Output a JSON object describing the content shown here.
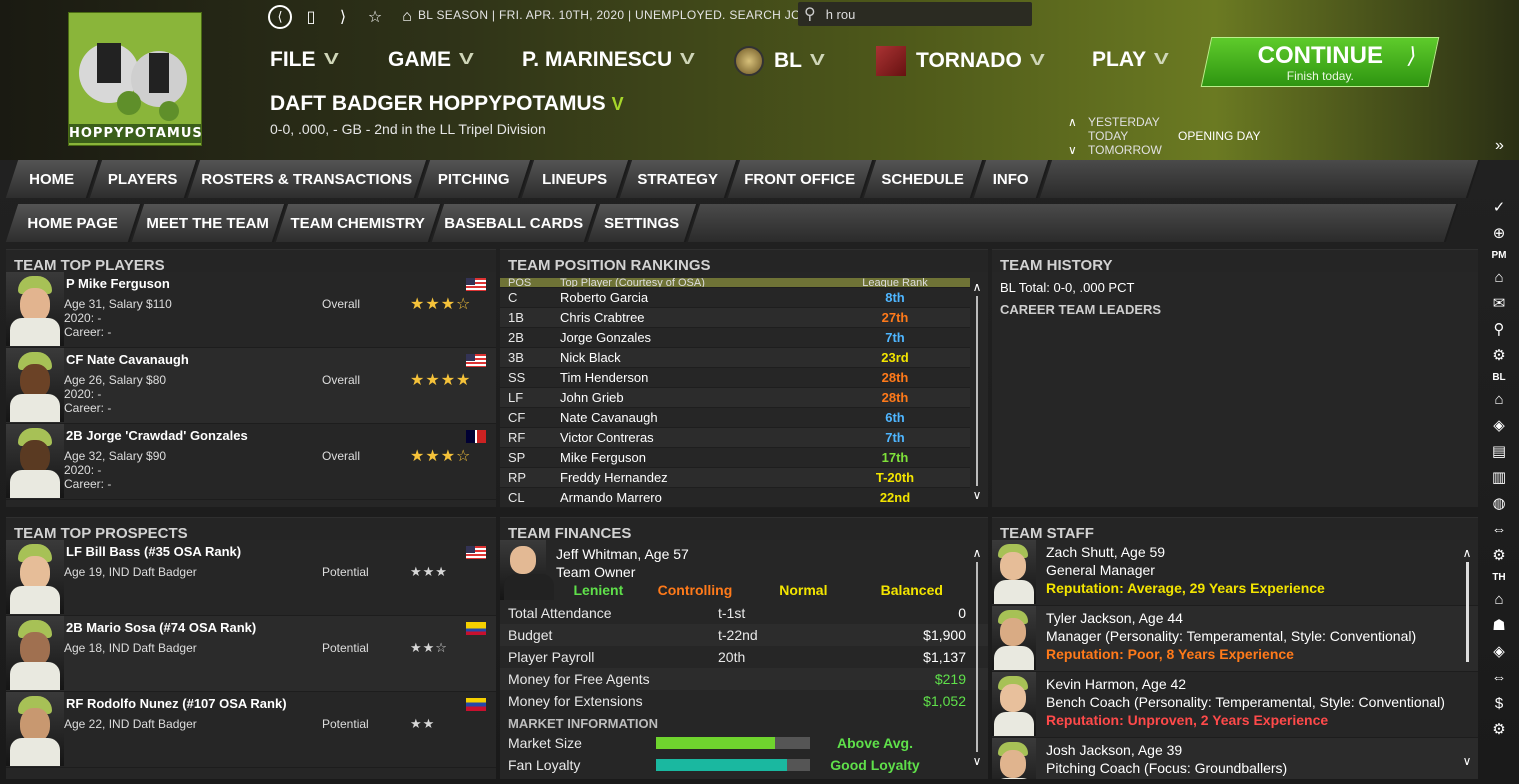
{
  "header": {
    "logo_text": "HOPPYPOTAMUS",
    "season_status": "BL SEASON  |  FRI. APR. 10TH, 2020  |  UNEMPLOYED. SEARCH JOBS...",
    "search_value": "h rou",
    "menu": {
      "file": "FILE",
      "game": "GAME",
      "manager": "P. MARINESCU",
      "league": "BL",
      "team": "TORNADO",
      "play": "PLAY"
    },
    "continue": {
      "title": "CONTINUE",
      "subtitle": "Finish today.",
      "arrow": "⟩"
    },
    "team_name": "DAFT BADGER HOPPYPOTAMUS",
    "team_record": "0-0, .000, - GB - 2nd in the LL Tripel Division",
    "day_nav": {
      "yesterday": "YESTERDAY",
      "today": "TODAY",
      "tomorrow": "TOMORROW",
      "event": "OPENING DAY"
    }
  },
  "tabs": [
    "HOME",
    "PLAYERS",
    "ROSTERS & TRANSACTIONS",
    "PITCHING",
    "LINEUPS",
    "STRATEGY",
    "FRONT OFFICE",
    "SCHEDULE",
    "INFO"
  ],
  "subtabs": [
    "HOME PAGE",
    "MEET THE TEAM",
    "TEAM CHEMISTRY",
    "BASEBALL CARDS",
    "SETTINGS"
  ],
  "top_players": {
    "title": "TEAM TOP PLAYERS",
    "rows": [
      {
        "name": "P Mike Ferguson",
        "line1": "Age 31, Salary $110",
        "line2": "2020: -",
        "line3": "Career: -",
        "label": "Overall",
        "stars": "★★★☆",
        "flag": "us"
      },
      {
        "name": "CF Nate Cavanaugh",
        "line1": "Age 26, Salary $80",
        "line2": "2020: -",
        "line3": "Career: -",
        "label": "Overall",
        "stars": "★★★★",
        "flag": "us"
      },
      {
        "name": "2B Jorge 'Crawdad' Gonzales",
        "line1": "Age 32, Salary $90",
        "line2": "2020: -",
        "line3": "Career: -",
        "label": "Overall",
        "stars": "★★★☆",
        "flag": "dr"
      }
    ]
  },
  "top_prospects": {
    "title": "TEAM TOP PROSPECTS",
    "rows": [
      {
        "name": "LF Bill Bass (#35 OSA Rank)",
        "line1": "Age 19, IND Daft Badger",
        "label": "Potential",
        "stars": "★★★",
        "flag": "us"
      },
      {
        "name": "2B Mario Sosa (#74 OSA Rank)",
        "line1": "Age 18, IND Daft Badger",
        "label": "Potential",
        "stars": "★★☆",
        "flag": "co"
      },
      {
        "name": "RF Rodolfo Nunez (#107 OSA Rank)",
        "line1": "Age 22, IND Daft Badger",
        "label": "Potential",
        "stars": "★★",
        "flag": "ve"
      }
    ]
  },
  "position_rankings": {
    "title": "TEAM POSITION RANKINGS",
    "headers": [
      "POS",
      "Top Player (Courtesy of OSA)",
      "League Rank"
    ],
    "rows": [
      {
        "pos": "C",
        "player": "Roberto Garcia",
        "rank": "8th",
        "color": "#4fb6ff"
      },
      {
        "pos": "1B",
        "player": "Chris Crabtree",
        "rank": "27th",
        "color": "#ff7a1a"
      },
      {
        "pos": "2B",
        "player": "Jorge Gonzales",
        "rank": "7th",
        "color": "#4fb6ff"
      },
      {
        "pos": "3B",
        "player": "Nick Black",
        "rank": "23rd",
        "color": "#f3e500"
      },
      {
        "pos": "SS",
        "player": "Tim Henderson",
        "rank": "28th",
        "color": "#ff7a1a"
      },
      {
        "pos": "LF",
        "player": "John Grieb",
        "rank": "28th",
        "color": "#ff7a1a"
      },
      {
        "pos": "CF",
        "player": "Nate Cavanaugh",
        "rank": "6th",
        "color": "#4fb6ff"
      },
      {
        "pos": "RF",
        "player": "Victor Contreras",
        "rank": "7th",
        "color": "#4fb6ff"
      },
      {
        "pos": "SP",
        "player": "Mike Ferguson",
        "rank": "17th",
        "color": "#7fe23a"
      },
      {
        "pos": "RP",
        "player": "Freddy Hernandez",
        "rank": "T-20th",
        "color": "#f3e500"
      },
      {
        "pos": "CL",
        "player": "Armando Marrero",
        "rank": "22nd",
        "color": "#f3e500"
      }
    ]
  },
  "history": {
    "title": "TEAM HISTORY",
    "bl_total": "BL Total: 0-0, .000 PCT",
    "career_leaders": "CAREER TEAM LEADERS"
  },
  "finances": {
    "title": "TEAM FINANCES",
    "owner": {
      "name": "Jeff Whitman, Age 57",
      "role": "Team Owner",
      "traits": [
        "Lenient",
        "Controlling",
        "Normal",
        "Balanced"
      ],
      "trait_colors": [
        "#5fe04a",
        "#ff7a1a",
        "#f3e500",
        "#f3e500"
      ]
    },
    "rows": [
      {
        "label": "Total Attendance",
        "rank": "t-1st",
        "value": "0",
        "color": "#ffffff"
      },
      {
        "label": "Budget",
        "rank": "t-22nd",
        "value": "$1,900",
        "color": "#ffffff"
      },
      {
        "label": "Player Payroll",
        "rank": "20th",
        "value": "$1,137",
        "color": "#ffffff"
      },
      {
        "label": "Money for Free Agents",
        "rank": "",
        "value": "$219",
        "color": "#5fe04a"
      },
      {
        "label": "Money for Extensions",
        "rank": "",
        "value": "$1,052",
        "color": "#5fe04a"
      }
    ],
    "market_title": "MARKET INFORMATION",
    "market": [
      {
        "label": "Market Size",
        "level": 0.77,
        "bar_color": "#6fd42e",
        "text": "Above Avg."
      },
      {
        "label": "Fan Loyalty",
        "level": 0.85,
        "bar_color": "#1ab8a0",
        "text": "Good Loyalty"
      }
    ]
  },
  "staff": {
    "title": "TEAM STAFF",
    "rows": [
      {
        "name": "Zach Shutt, Age 59",
        "role": "General Manager",
        "rep": "Reputation: Average, 29 Years Experience",
        "rep_color": "#f3e500"
      },
      {
        "name": "Tyler Jackson, Age 44",
        "role": "Manager (Personality: Temperamental, Style: Conventional)",
        "rep": "Reputation: Poor, 8 Years Experience",
        "rep_color": "#ff7a1a"
      },
      {
        "name": "Kevin Harmon, Age 42",
        "role": "Bench Coach (Personality: Temperamental, Style: Conventional)",
        "rep": "Reputation: Unproven, 2 Years Experience",
        "rep_color": "#ff4a4a"
      },
      {
        "name": "Josh Jackson, Age 39",
        "role": "Pitching Coach (Focus: Groundballers)",
        "rep": "",
        "rep_color": "#ffffff"
      }
    ]
  },
  "sidebar": {
    "pm_label": "PM",
    "bl_label": "BL",
    "th_label": "TH",
    "expand_icon": "»"
  }
}
